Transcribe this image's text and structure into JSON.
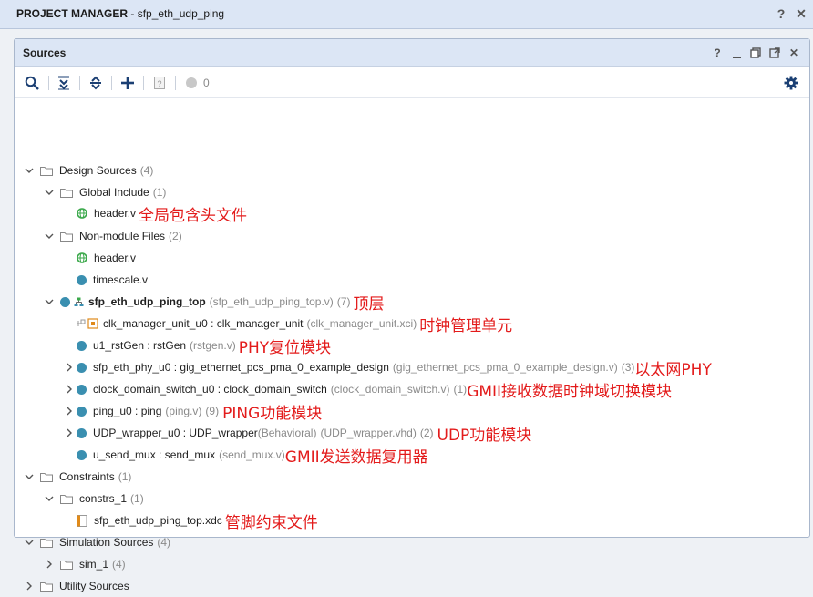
{
  "window": {
    "title_prefix": "PROJECT MANAGER",
    "title_sep": " - ",
    "project": "sfp_eth_udp_ping",
    "help": "?",
    "close": "✕"
  },
  "panel": {
    "title": "Sources",
    "help": "?",
    "minimize": "—",
    "restore": "▢",
    "float": "⧉",
    "close": "✕"
  },
  "toolbar": {
    "count": "0"
  },
  "tree": {
    "design_sources": {
      "label": "Design Sources",
      "count": "(4)"
    },
    "global_include": {
      "label": "Global Include",
      "count": "(1)"
    },
    "header_v_1": {
      "label": "header.v",
      "note": "全局包含头文件"
    },
    "non_module": {
      "label": "Non-module Files",
      "count": "(2)"
    },
    "header_v_2": {
      "label": "header.v"
    },
    "timescale": {
      "label": "timescale.v"
    },
    "top": {
      "label": "sfp_eth_udp_ping_top",
      "file": "(sfp_eth_udp_ping_top.v)",
      "count": "(7)",
      "note": "顶层"
    },
    "clk_mgr": {
      "label": "clk_manager_unit_u0 : clk_manager_unit",
      "file": "(clk_manager_unit.xci)",
      "note": "时钟管理单元"
    },
    "rst_gen": {
      "label": "u1_rstGen : rstGen",
      "file": "(rstgen.v)",
      "note": "PHY复位模块"
    },
    "sfp_phy": {
      "label": "sfp_eth_phy_u0 : gig_ethernet_pcs_pma_0_example_design",
      "file": "(gig_ethernet_pcs_pma_0_example_design.v)",
      "count": "(3)",
      "note": "以太网PHY"
    },
    "clk_switch": {
      "label": "clock_domain_switch_u0 : clock_domain_switch",
      "file": "(clock_domain_switch.v)",
      "count": "(1)",
      "note": "GMII接收数据时钟域切换模块"
    },
    "ping": {
      "label": "ping_u0 : ping",
      "file": "(ping.v)",
      "count": "(9)",
      "note": "PING功能模块"
    },
    "udp": {
      "label": "UDP_wrapper_u0 : UDP_wrapper",
      "behavioral": "(Behavioral)",
      "file": "(UDP_wrapper.vhd)",
      "count": "(2)",
      "note": "UDP功能模块"
    },
    "send_mux": {
      "label": "u_send_mux : send_mux",
      "file": "(send_mux.v)",
      "note": "GMII发送数据复用器"
    },
    "constraints": {
      "label": "Constraints",
      "count": "(1)"
    },
    "constrs_1": {
      "label": "constrs_1",
      "count": "(1)"
    },
    "xdc": {
      "label": "sfp_eth_udp_ping_top.xdc",
      "note": "管脚约束文件"
    },
    "sim_sources": {
      "label": "Simulation Sources",
      "count": "(4)"
    },
    "sim_1": {
      "label": "sim_1",
      "count": "(4)"
    },
    "utility": {
      "label": "Utility Sources"
    }
  },
  "colors": {
    "accent": "#3a8fb0",
    "note": "#e31b1b",
    "header_bg": "#dce6f5"
  }
}
